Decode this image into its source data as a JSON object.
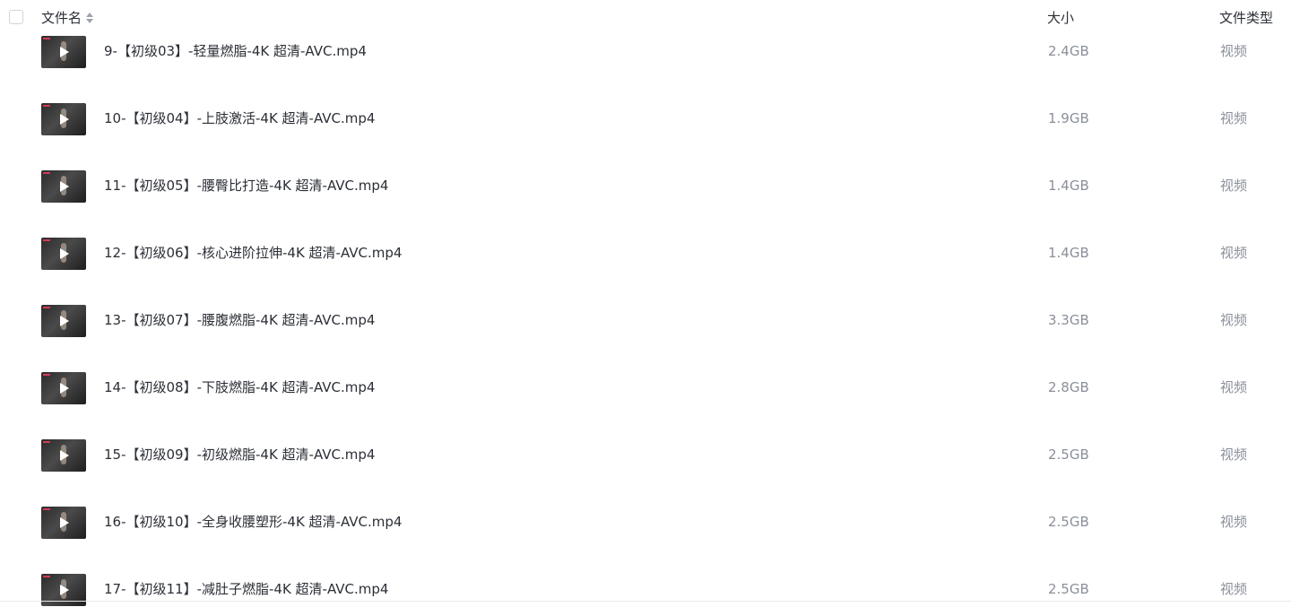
{
  "header": {
    "name_label": "文件名",
    "size_label": "大小",
    "type_label": "文件类型"
  },
  "files": [
    {
      "name": "9-【初级03】-轻量燃脂-4K 超清-AVC.mp4",
      "size": "2.4GB",
      "type": "视频"
    },
    {
      "name": "10-【初级04】-上肢激活-4K 超清-AVC.mp4",
      "size": "1.9GB",
      "type": "视频"
    },
    {
      "name": "11-【初级05】-腰臀比打造-4K 超清-AVC.mp4",
      "size": "1.4GB",
      "type": "视频"
    },
    {
      "name": "12-【初级06】-核心进阶拉伸-4K 超清-AVC.mp4",
      "size": "1.4GB",
      "type": "视频"
    },
    {
      "name": "13-【初级07】-腰腹燃脂-4K 超清-AVC.mp4",
      "size": "3.3GB",
      "type": "视频"
    },
    {
      "name": "14-【初级08】-下肢燃脂-4K 超清-AVC.mp4",
      "size": "2.8GB",
      "type": "视频"
    },
    {
      "name": "15-【初级09】-初级燃脂-4K 超清-AVC.mp4",
      "size": "2.5GB",
      "type": "视频"
    },
    {
      "name": "16-【初级10】-全身收腰塑形-4K 超清-AVC.mp4",
      "size": "2.5GB",
      "type": "视频"
    },
    {
      "name": "17-【初级11】-减肚子燃脂-4K 超清-AVC.mp4",
      "size": "2.5GB",
      "type": "视频"
    }
  ]
}
